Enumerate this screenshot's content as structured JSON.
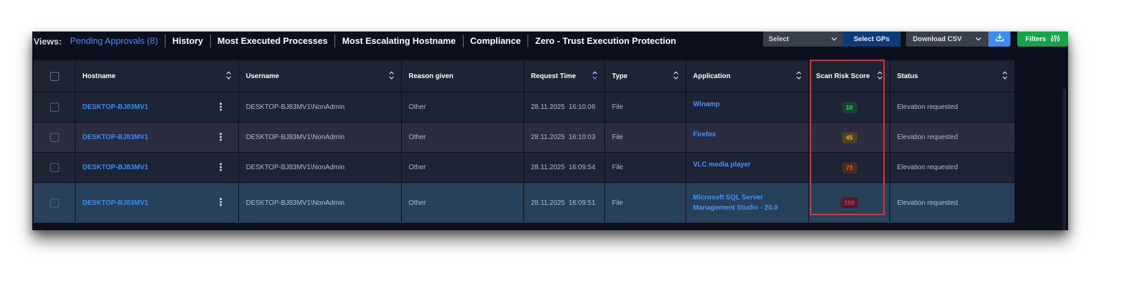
{
  "views": {
    "label": "Views:",
    "items": [
      {
        "label": "Pending Approvals (8)",
        "active": true
      },
      {
        "label": "History"
      },
      {
        "label": "Most Executed Processes"
      },
      {
        "label": "Most Escalating Hostname"
      },
      {
        "label": "Compliance"
      },
      {
        "label": "Zero - Trust Execution Protection"
      }
    ]
  },
  "toolbar": {
    "select_placeholder": "Select",
    "select_gps_label": "Select GPs",
    "download_label": "Download CSV",
    "filters_label": "Filters"
  },
  "table": {
    "headers": [
      "Hostname",
      "Username",
      "Reason given",
      "Request Time",
      "Type",
      "Application",
      "Scan Risk Score",
      "Status"
    ],
    "rows": [
      {
        "hostname": "DESKTOP-BJ83MV1",
        "username": "DESKTOP-BJ83MV1\\NonAdmin",
        "reason": "Other",
        "time": "28.11.2025  16:10:06",
        "type": "File",
        "application": "Winamp",
        "score": "10",
        "status": "Elevation requested"
      },
      {
        "hostname": "DESKTOP-BJ83MV1",
        "username": "DESKTOP-BJ83MV1\\NonAdmin",
        "reason": "Other",
        "time": "28.11.2025  16:10:03",
        "type": "File",
        "application": "Firefox",
        "score": "45",
        "status": "Elevation requested"
      },
      {
        "hostname": "DESKTOP-BJ83MV1",
        "username": "DESKTOP-BJ83MV1\\NonAdmin",
        "reason": "Other",
        "time": "28.11.2025  16:09:54",
        "type": "File",
        "application": "VLC media player",
        "score": "73",
        "status": "Elevation requested"
      },
      {
        "hostname": "DESKTOP-BJ83MV1",
        "username": "DESKTOP-BJ83MV1\\NonAdmin",
        "reason": "Other",
        "time": "28.11.2025  16:09:51",
        "type": "File",
        "application": "Microsoft SQL Server Management Studio - 20.0",
        "score": "100",
        "status": "Elevation requested"
      }
    ]
  },
  "score_colors": {
    "low": {
      "bg": "#14432f",
      "fg": "#2fcf6a"
    },
    "medium": {
      "bg": "#4f4222",
      "fg": "#e6b422"
    },
    "high": {
      "bg": "#4b2a22",
      "fg": "#e8661e"
    },
    "critical": {
      "bg": "#4c1d2c",
      "fg": "#e52c4c"
    }
  }
}
